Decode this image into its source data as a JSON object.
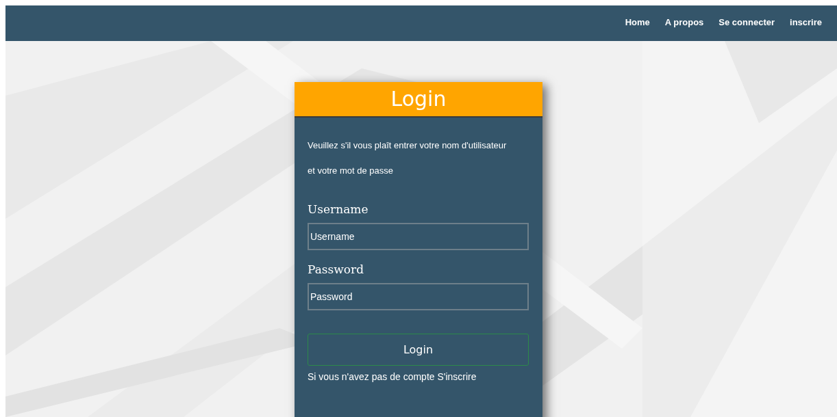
{
  "nav": {
    "items": [
      {
        "label": "Home"
      },
      {
        "label": "A propos"
      },
      {
        "label": "Se connecter"
      },
      {
        "label": "inscrire"
      }
    ]
  },
  "login": {
    "title": "Login",
    "intro": "Veuillez s'il vous plaît entrer votre nom d'utilisateur et votre mot de passe",
    "fields": [
      {
        "label": "Username",
        "placeholder": "Username"
      },
      {
        "label": "Password",
        "placeholder": "Password"
      }
    ],
    "button": "Login",
    "footer": "Si vous n'avez pas de compte S'inscrire"
  }
}
